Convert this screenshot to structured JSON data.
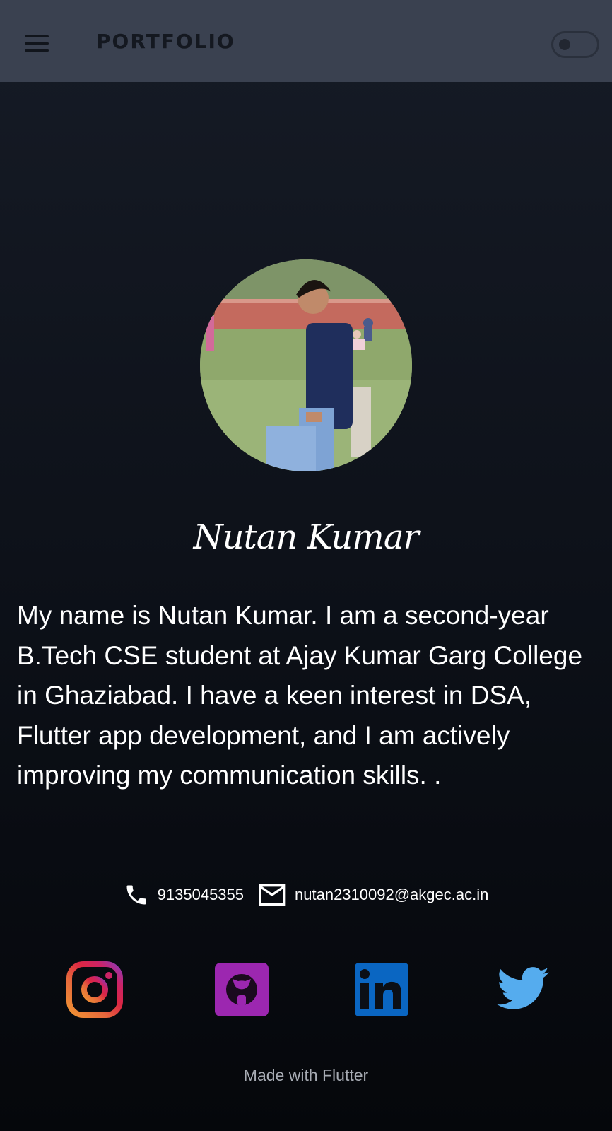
{
  "appbar": {
    "title": "PORTFOLIO",
    "menu_icon": "menu-icon",
    "theme_toggle": "off"
  },
  "profile": {
    "name": "Nutan Kumar",
    "bio": "My name is Nutan Kumar. I am a second-year B.Tech CSE student at Ajay Kumar Garg College in Ghaziabad. I have a keen interest in DSA, Flutter app development, and I am actively improving my communication skills. ."
  },
  "contact": {
    "phone": "9135045355",
    "phone_icon": "phone-icon",
    "email": "nutan2310092@akgec.ac.in",
    "email_icon": "mail-icon"
  },
  "social": [
    {
      "icon": "instagram-icon",
      "color": "#dc2743"
    },
    {
      "icon": "github-icon",
      "color": "#9c27b0"
    },
    {
      "icon": "linkedin-icon",
      "color": "#0a66c2"
    },
    {
      "icon": "twitter-icon",
      "color": "#55acee"
    }
  ],
  "footer": {
    "text": "Made with Flutter"
  },
  "colors": {
    "appbar_bg": "#3a4150",
    "page_bg_top": "#161b26",
    "page_bg_bottom": "#05070b",
    "text": "#ffffff",
    "footer_text": "#a7abb3"
  }
}
